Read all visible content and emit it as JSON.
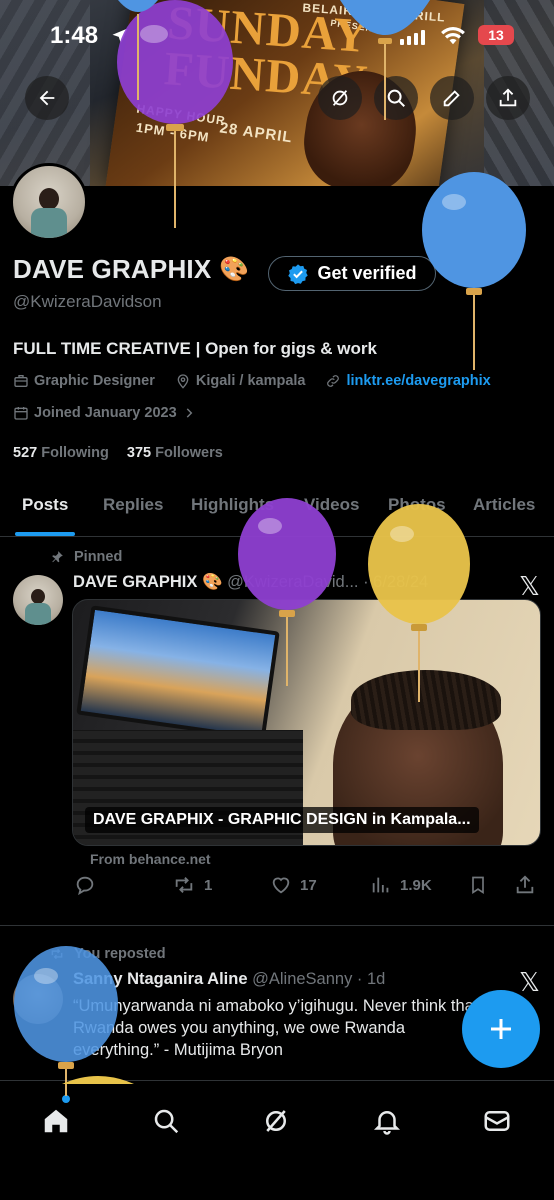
{
  "status_bar": {
    "time": "1:48",
    "battery": "13"
  },
  "banner": {
    "poster_title_line1": "SUNDAY",
    "poster_title_line2": "FUNDAY",
    "poster_brand": "BELAIR BAR & GRILL",
    "poster_presents": "PRESENTS",
    "poster_happy_hour": "HAPPY HOUR",
    "poster_hours": "1PM - 6PM",
    "poster_date": "28 APRIL"
  },
  "profile": {
    "name": "DAVE GRAPHIX",
    "name_emoji": "🎨",
    "verify_label": "Get verified",
    "handle": "@KwizeraDavidson",
    "bio": "FULL TIME CREATIVE | Open for gigs & work",
    "category": "Graphic Designer",
    "location": "Kigali / kampala",
    "link": "linktr.ee/davegraphix",
    "joined": "Joined January 2023",
    "following_count": "527",
    "following_label": "Following",
    "followers_count": "375",
    "followers_label": "Followers"
  },
  "tabs": [
    {
      "label": "Posts"
    },
    {
      "label": "Replies"
    },
    {
      "label": "Highlights"
    },
    {
      "label": "Videos"
    },
    {
      "label": "Photos"
    },
    {
      "label": "Articles"
    }
  ],
  "pinned_post": {
    "pinned_label": "Pinned",
    "author": "DAVE GRAPHIX 🎨",
    "handle_date": "@KwizeraDavid... · 6/28/24",
    "card_title": "DAVE GRAPHIX - GRAPHIC DESIGN in Kampala...",
    "card_source": "From behance.net",
    "retweets": "1",
    "likes": "17",
    "views": "1.9K"
  },
  "repost": {
    "label": "You reposted",
    "author": "Sanny Ntaganira Aline",
    "handle_time": "@AlineSanny · 1d",
    "text": "“Umunyarwanda ni amaboko y’igihugu. Never think that Rwanda owes you anything, we owe Rwanda everything.” - Mutijima Bryon"
  },
  "colors": {
    "accent": "#1d9bf0",
    "balloon_purple": "#8e3fd1",
    "balloon_blue": "#4f95e2",
    "balloon_yellow": "#e8c34a"
  }
}
